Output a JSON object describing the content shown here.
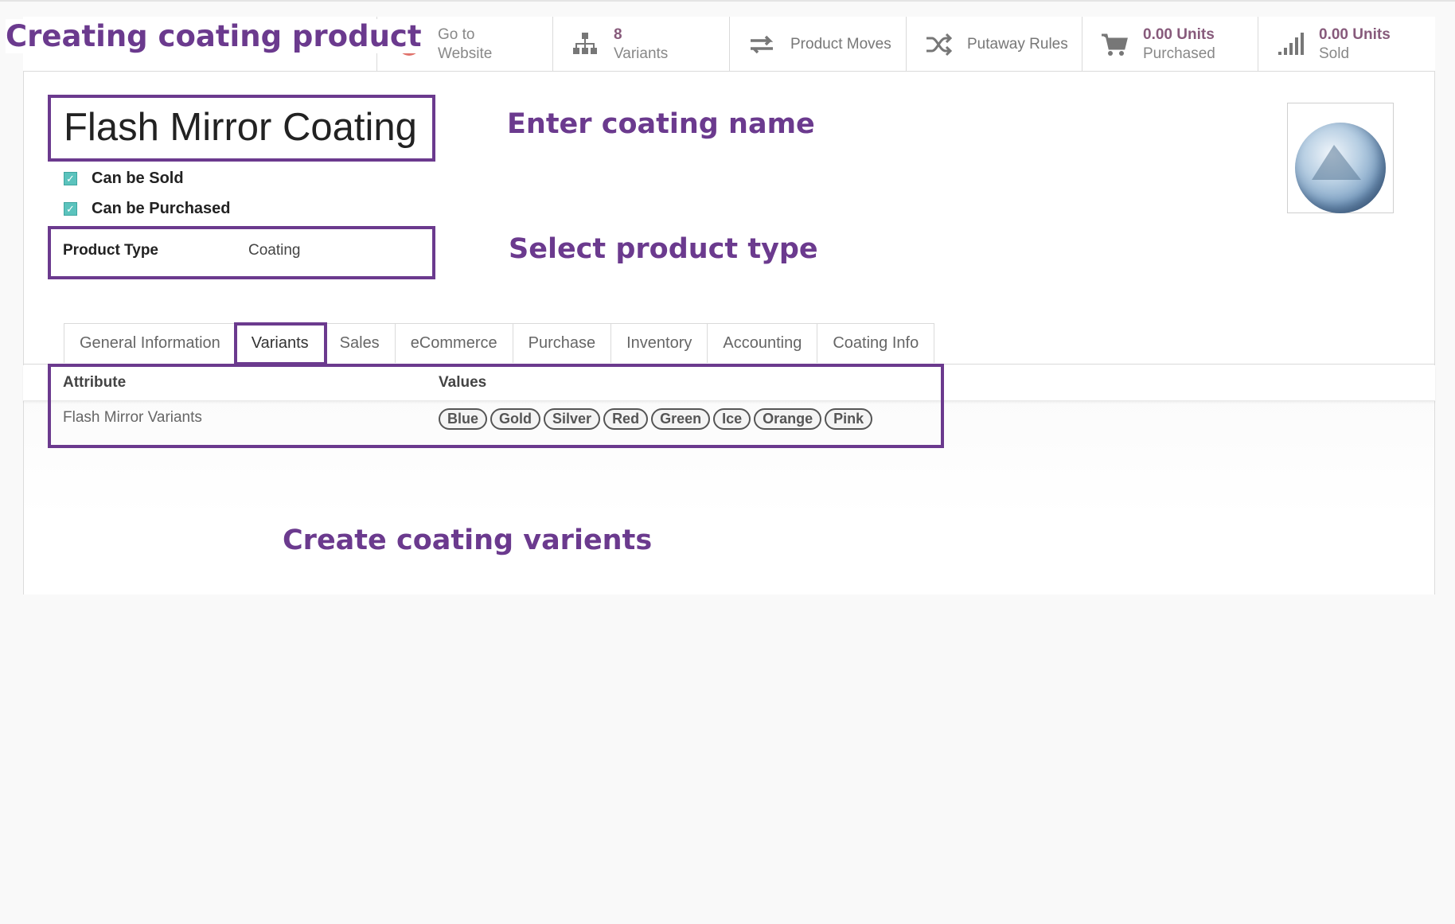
{
  "annotations": {
    "title": "Creating coating product",
    "enter_name": "Enter coating name",
    "select_type": "Select product type",
    "create_variants": "Create coating varients"
  },
  "smart_buttons": {
    "website": {
      "line1": "Go to",
      "line2": "Website",
      "icon": "globe-icon"
    },
    "variants": {
      "count": "8",
      "label": "Variants",
      "icon": "sitemap-icon"
    },
    "moves": {
      "label": "Product Moves",
      "icon": "exchange-arrows-icon"
    },
    "putaway": {
      "label": "Putaway Rules",
      "icon": "shuffle-icon"
    },
    "purchased": {
      "value": "0.00 Units",
      "label": "Purchased",
      "icon": "cart-icon"
    },
    "sold": {
      "value": "0.00 Units",
      "label": "Sold",
      "icon": "signal-bars-icon"
    }
  },
  "product": {
    "name": "Flash Mirror Coating",
    "can_be_sold_label": "Can be Sold",
    "can_be_sold": true,
    "can_be_purchased_label": "Can be Purchased",
    "can_be_purchased": true,
    "product_type_label": "Product Type",
    "product_type": "Coating"
  },
  "tabs": [
    {
      "label": "General Information"
    },
    {
      "label": "Variants",
      "active": true
    },
    {
      "label": "Sales"
    },
    {
      "label": "eCommerce"
    },
    {
      "label": "Purchase"
    },
    {
      "label": "Inventory"
    },
    {
      "label": "Accounting"
    },
    {
      "label": "Coating Info"
    }
  ],
  "variants_table": {
    "col_attribute": "Attribute",
    "col_values": "Values",
    "rows": [
      {
        "attribute": "Flash Mirror Variants",
        "values": [
          "Blue",
          "Gold",
          "Silver",
          "Red",
          "Green",
          "Ice",
          "Orange",
          "Pink"
        ]
      }
    ]
  },
  "colors": {
    "annotation": "#6b3a8e",
    "accent": "#875a7b",
    "checkbox": "#5bc3bd"
  }
}
